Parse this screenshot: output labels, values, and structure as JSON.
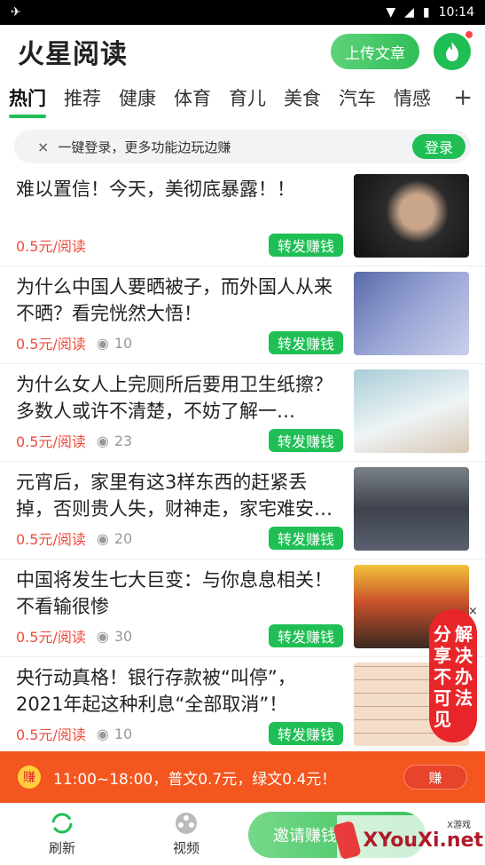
{
  "status_bar": {
    "time": "10:14"
  },
  "header": {
    "title": "火星阅读",
    "upload_label": "上传文章"
  },
  "tabs": [
    {
      "label": "热门"
    },
    {
      "label": "推荐"
    },
    {
      "label": "健康"
    },
    {
      "label": "体育"
    },
    {
      "label": "育儿"
    },
    {
      "label": "美食"
    },
    {
      "label": "汽车"
    },
    {
      "label": "情感"
    }
  ],
  "tab_plus": "+",
  "login_bar": {
    "close": "×",
    "text": "一键登录，更多功能边玩边赚",
    "button": "登录"
  },
  "articles": [
    {
      "title": "难以置信！今天，美彻底暴露！！",
      "price": "0.5元/阅读",
      "views": "",
      "share": "转发赚钱",
      "thumb_color": "#3a3a3a"
    },
    {
      "title": "为什么中国人要晒被子，而外国人从来不晒？看完恍然大悟！",
      "price": "0.5元/阅读",
      "views": "10",
      "share": "转发赚钱",
      "thumb_color": "#7f88b6"
    },
    {
      "title": "为什么女人上完厕所后要用卫生纸擦？多数人或许不清楚，不妨了解一…",
      "price": "0.5元/阅读",
      "views": "23",
      "share": "转发赚钱",
      "thumb_color": "#c6dde4"
    },
    {
      "title": "元宵后，家里有这3样东西的赶紧丢掉，否则贵人失，财神走，家宅难安…",
      "price": "0.5元/阅读",
      "views": "20",
      "share": "转发赚钱",
      "thumb_color": "#4d5260"
    },
    {
      "title": "中国将发生七大巨变：与你息息相关！不看输很惨",
      "price": "0.5元/阅读",
      "views": "30",
      "share": "转发赚钱",
      "thumb_color": "#b8622e"
    },
    {
      "title": "央行动真格！银行存款被“叫停”，2021年起这种利息“全部取消”！",
      "price": "0.5元/阅读",
      "views": "10",
      "share": "转发赚钱",
      "thumb_color": "#e8c9b0"
    }
  ],
  "banner": {
    "icon": "赚",
    "text": "11:00~18:00，普文0.7元，绿文0.4元！",
    "button": "赚"
  },
  "bottom_nav": {
    "refresh": "刷新",
    "video": "视频",
    "invite": "邀请赚钱"
  },
  "float_ad": {
    "col1": "分享不可见",
    "col2": "解决办法",
    "close": "×"
  },
  "watermark": {
    "text": "XYouXi.net",
    "sub": "X游戏"
  },
  "colors": {
    "accent": "#1fbf55",
    "price": "#ef4b3e",
    "banner": "#f3561e"
  }
}
